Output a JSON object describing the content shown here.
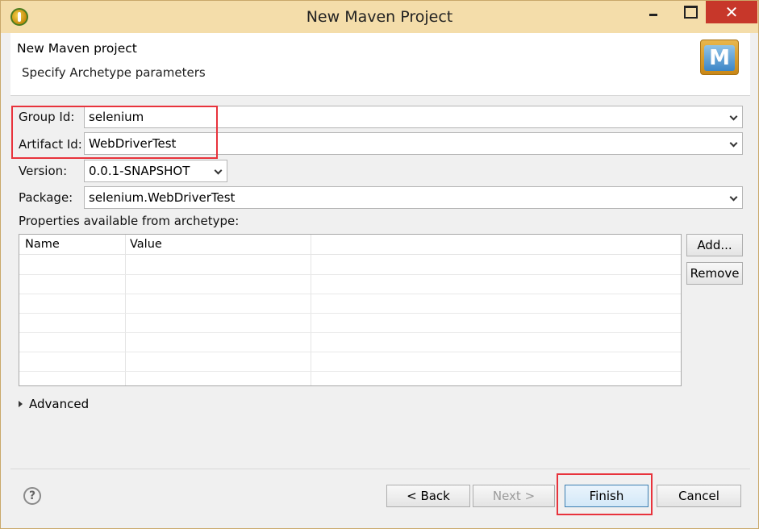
{
  "window": {
    "title": "New Maven Project"
  },
  "header": {
    "title": "New Maven project",
    "description": "Specify Archetype parameters",
    "icon_letter": "M"
  },
  "form": {
    "group_id_label": "Group Id:",
    "group_id_value": "selenium",
    "artifact_id_label": "Artifact Id:",
    "artifact_id_value": "WebDriverTest",
    "version_label": "Version:",
    "version_value": "0.0.1-SNAPSHOT",
    "package_label": "Package:",
    "package_value": "selenium.WebDriverTest",
    "properties_label": "Properties available from archetype:"
  },
  "table": {
    "columns": [
      "Name",
      "Value"
    ],
    "rows": []
  },
  "side_buttons": {
    "add": "Add...",
    "remove": "Remove"
  },
  "advanced_label": "Advanced",
  "footer": {
    "back": "< Back",
    "next": "Next >",
    "finish": "Finish",
    "cancel": "Cancel",
    "help_glyph": "?"
  },
  "colors": {
    "titlebar": "#f4ddaa",
    "close_button": "#c7372a",
    "highlight": "#e8333c"
  }
}
